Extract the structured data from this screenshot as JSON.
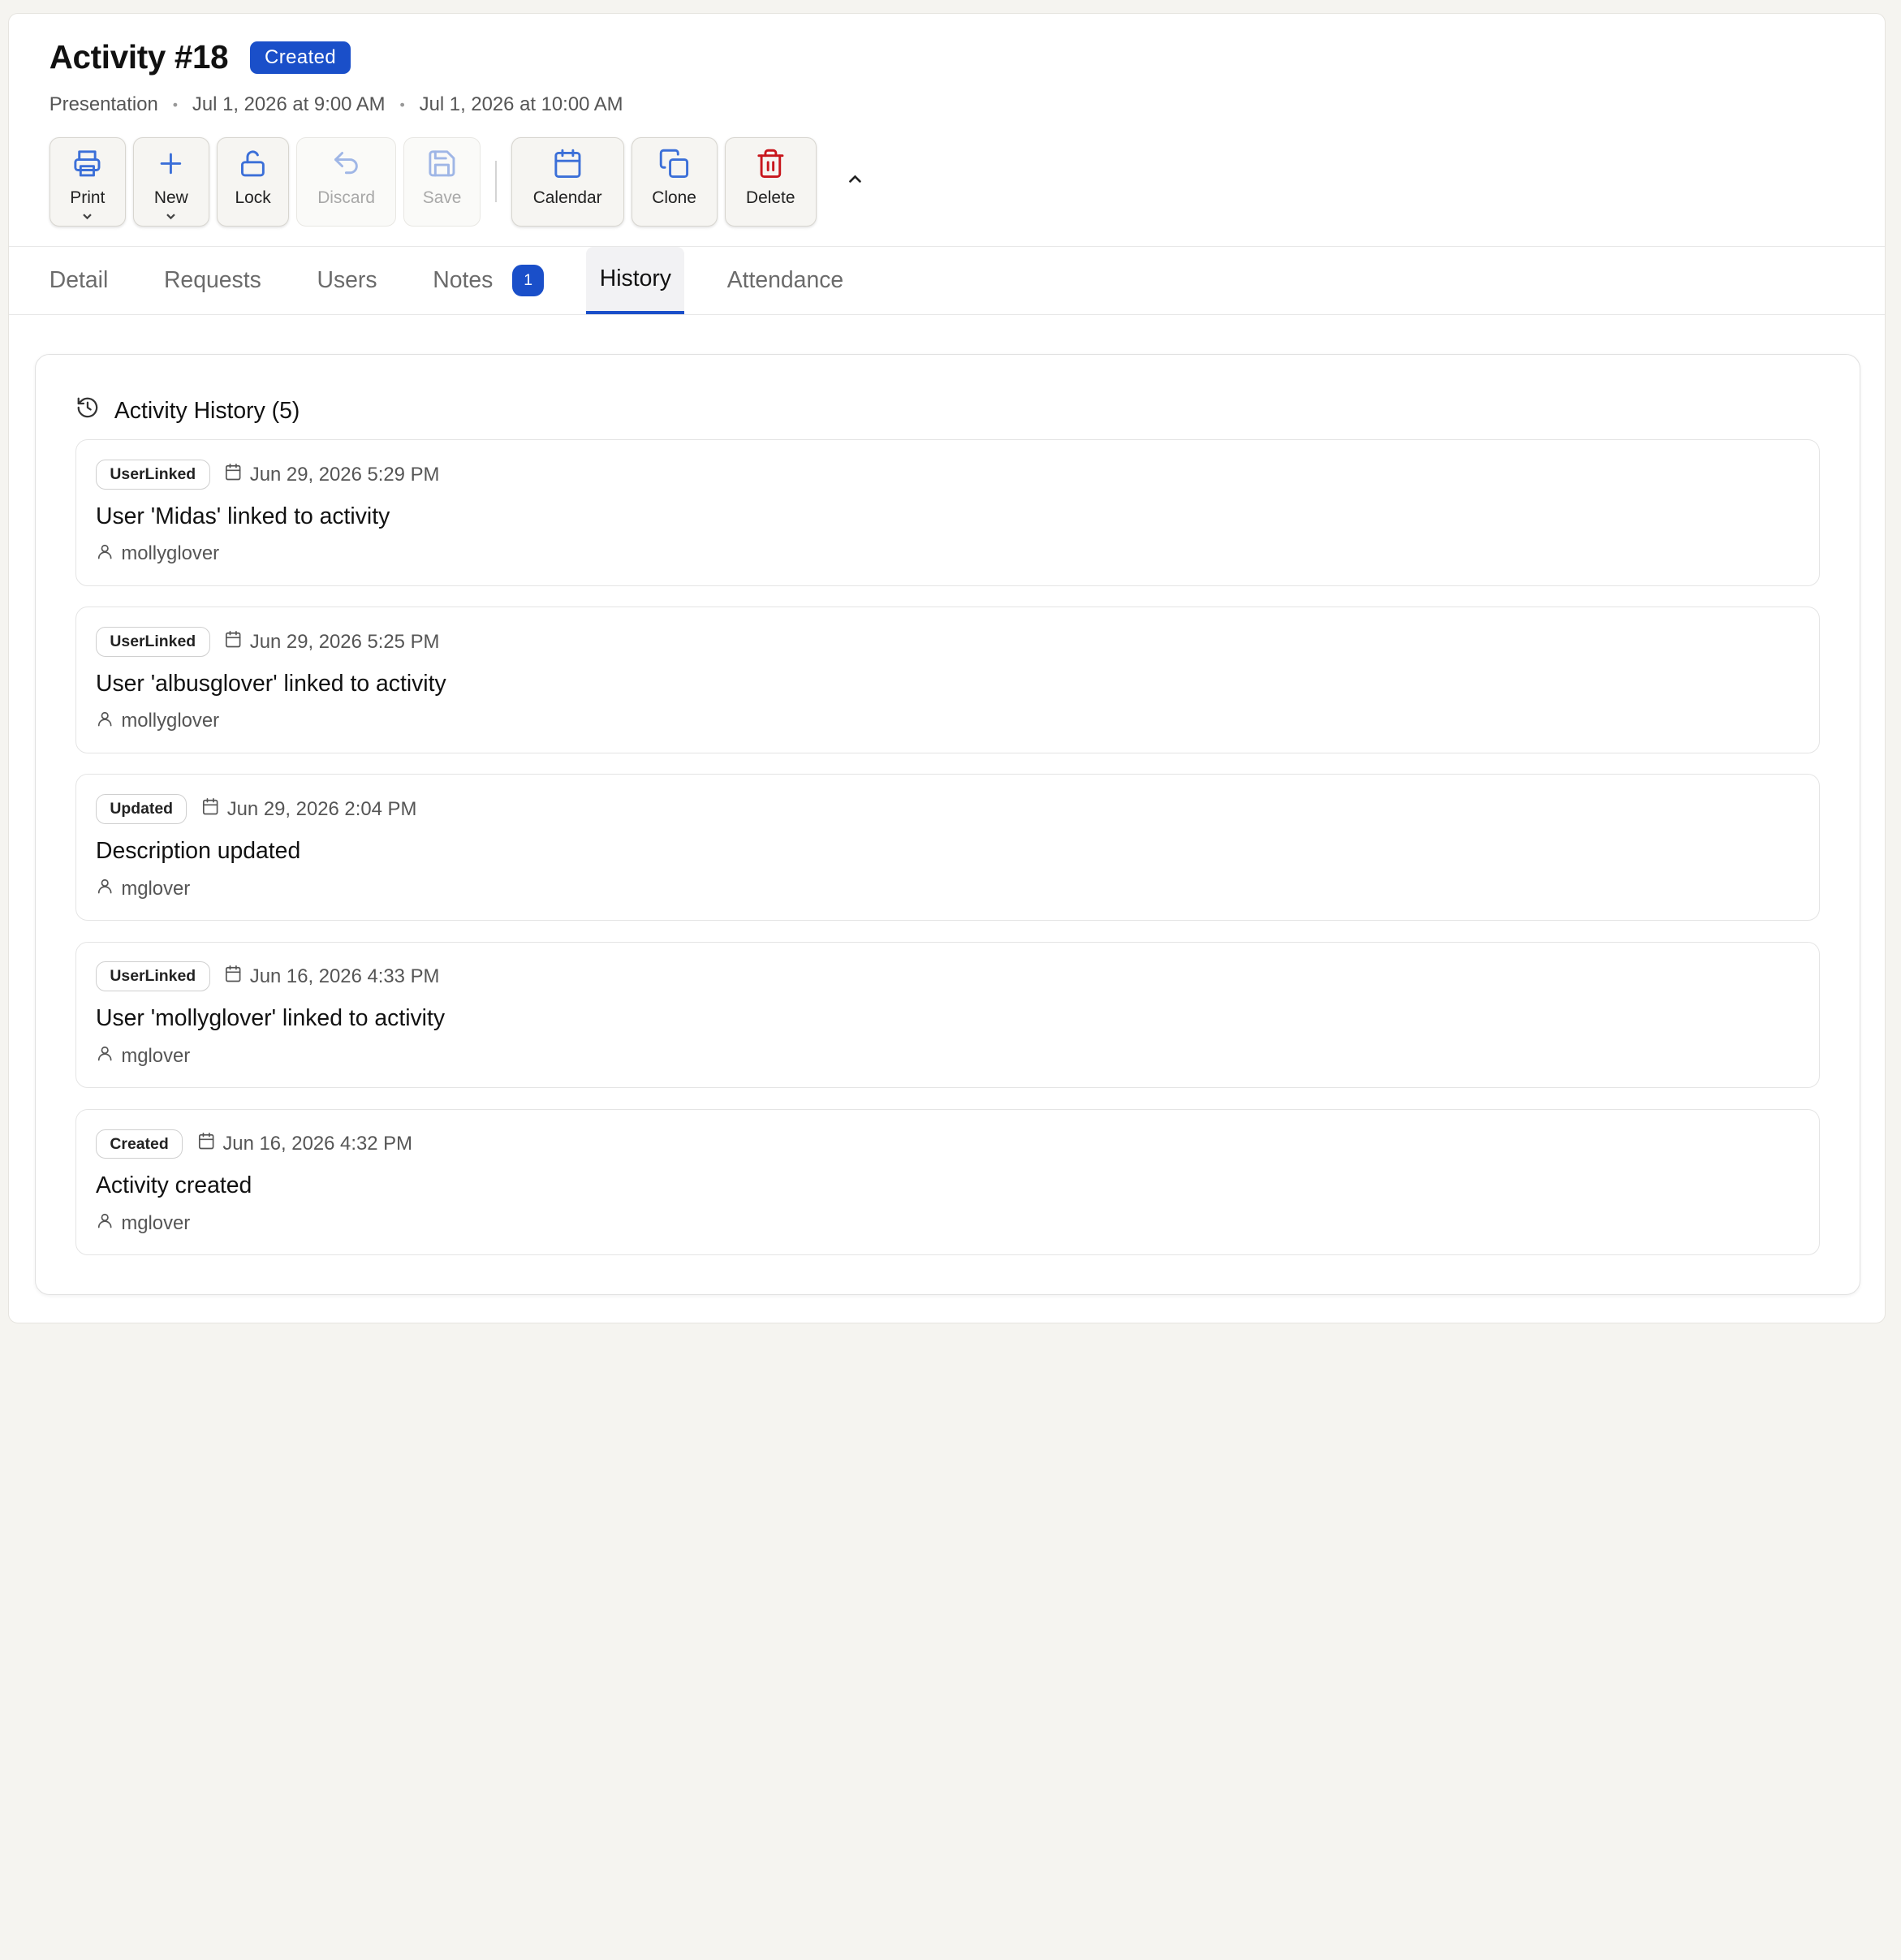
{
  "header": {
    "title": "Activity #18",
    "status": "Created",
    "meta": {
      "type": "Presentation",
      "start": "Jul 1, 2026 at 9:00 AM",
      "end": "Jul 1, 2026 at 10:00 AM",
      "separator": "•"
    }
  },
  "toolbar": {
    "print": "Print",
    "new": "New",
    "lock": "Lock",
    "discard": "Discard",
    "save": "Save",
    "calendar": "Calendar",
    "clone": "Clone",
    "delete": "Delete"
  },
  "tabs": [
    {
      "label": "Detail"
    },
    {
      "label": "Requests"
    },
    {
      "label": "Users"
    },
    {
      "label": "Notes",
      "badge": "1"
    },
    {
      "label": "History"
    },
    {
      "label": "Attendance"
    }
  ],
  "history": {
    "title": "Activity History (5)",
    "entries": [
      {
        "type": "UserLinked",
        "date": "Jun 29, 2026 5:29 PM",
        "description": "User 'Midas' linked to activity",
        "user": "mollyglover"
      },
      {
        "type": "UserLinked",
        "date": "Jun 29, 2026 5:25 PM",
        "description": "User 'albusglover' linked to activity",
        "user": "mollyglover"
      },
      {
        "type": "Updated",
        "date": "Jun 29, 2026 2:04 PM",
        "description": "Description updated",
        "user": "mglover"
      },
      {
        "type": "UserLinked",
        "date": "Jun 16, 2026 4:33 PM",
        "description": "User 'mollyglover' linked to activity",
        "user": "mglover"
      },
      {
        "type": "Created",
        "date": "Jun 16, 2026 4:32 PM",
        "description": "Activity created",
        "user": "mglover"
      }
    ]
  },
  "colors": {
    "accent": "#1a4fc9",
    "icon_blue": "#3b6fd8",
    "delete_red": "#c8161d",
    "disabled": "#a8a8a8"
  },
  "icons": {
    "print": "printer-icon",
    "new": "plus-icon",
    "lock": "lock-open-icon",
    "discard": "undo-icon",
    "save": "save-icon",
    "calendar": "calendar-icon",
    "clone": "copy-icon",
    "delete": "trash-icon",
    "history": "history-icon",
    "date": "calendar-icon",
    "user": "user-icon"
  }
}
